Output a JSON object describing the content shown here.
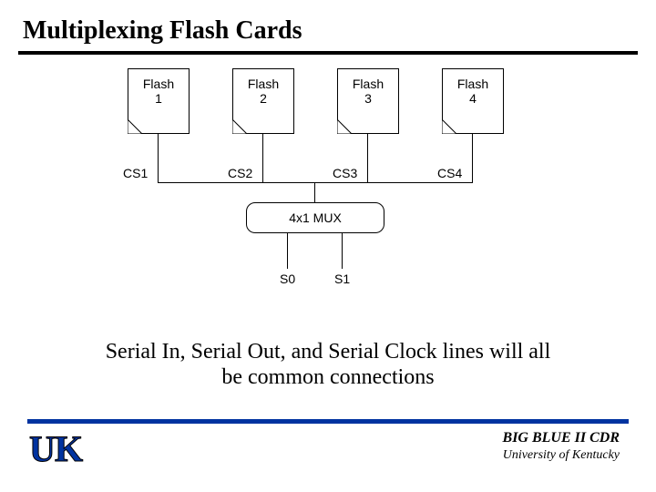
{
  "title": "Multiplexing Flash Cards",
  "flash": [
    {
      "line1": "Flash",
      "line2": "1",
      "cs": "CS1"
    },
    {
      "line1": "Flash",
      "line2": "2",
      "cs": "CS2"
    },
    {
      "line1": "Flash",
      "line2": "3",
      "cs": "CS3"
    },
    {
      "line1": "Flash",
      "line2": "4",
      "cs": "CS4"
    }
  ],
  "mux": "4x1 MUX",
  "mux_out": {
    "s0": "S0",
    "s1": "S1"
  },
  "caption_line1": "Serial In, Serial Out, and Serial Clock lines will all",
  "caption_line2": "be common connections",
  "footer": {
    "title": "BIG BLUE II CDR",
    "sub": "University of Kentucky"
  },
  "logo": {
    "text": "UK"
  }
}
